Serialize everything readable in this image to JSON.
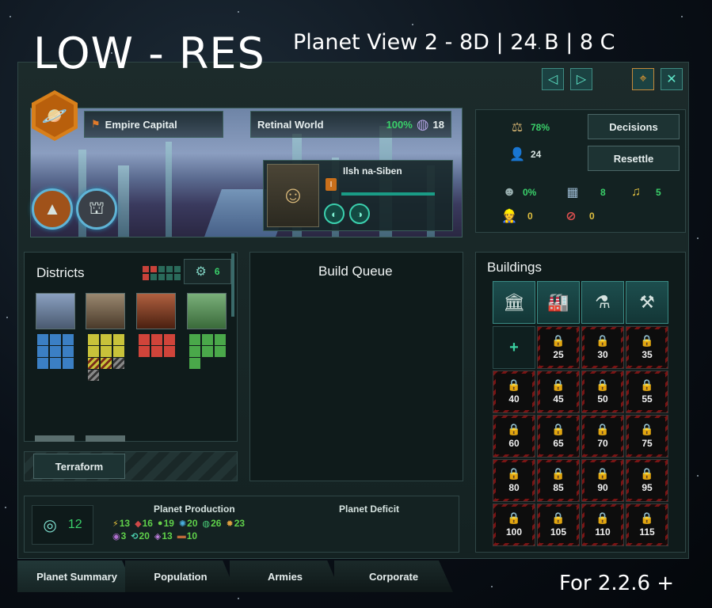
{
  "overlay": {
    "title": "LOW - RES",
    "subtitle": "Planet View 2 - 8D | 24 B | 8 C",
    "version": "For 2.2.6 +"
  },
  "header": {
    "capital_label": "Empire Capital",
    "planet_class": "Retinal World",
    "habitability": "100%",
    "planet_size": "18"
  },
  "leader": {
    "name": "Ilsh na-Siben",
    "level": "I"
  },
  "stats": {
    "stability": "78%",
    "population": "24",
    "crime": "0%",
    "housing": "8",
    "amenities": "5",
    "free_jobs": "0",
    "unemployed": "0",
    "decisions_label": "Decisions",
    "resettle_label": "Resettle"
  },
  "districts": {
    "title": "Districts",
    "free_slots": "6",
    "terraform_label": "Terraform",
    "colors": {
      "city": "#3b7fc4",
      "industry": "#c8c23a",
      "mining": "#d0443a",
      "farm": "#4aa84a"
    }
  },
  "build_queue": {
    "title": "Build Queue"
  },
  "buildings": {
    "title": "Buildings",
    "locked_slots": [
      "25",
      "30",
      "35",
      "40",
      "45",
      "50",
      "55",
      "60",
      "65",
      "70",
      "75",
      "80",
      "85",
      "90",
      "95",
      "100",
      "105",
      "110",
      "115"
    ]
  },
  "production": {
    "title": "Planet Production",
    "deficit_title": "Planet Deficit",
    "trade": "12",
    "row1": [
      {
        "icon": "energy-icon",
        "glyph": "⚡",
        "color": "#e6c23a",
        "value": "13"
      },
      {
        "icon": "minerals-icon",
        "glyph": "◆",
        "color": "#d04848",
        "value": "16"
      },
      {
        "icon": "food-icon",
        "glyph": "●",
        "color": "#6ad04a",
        "value": "19"
      },
      {
        "icon": "physics-icon",
        "glyph": "✺",
        "color": "#4ab0e0",
        "value": "20"
      },
      {
        "icon": "society-icon",
        "glyph": "◍",
        "color": "#4ad07a",
        "value": "26"
      },
      {
        "icon": "engineering-icon",
        "glyph": "✹",
        "color": "#e0a040",
        "value": "23"
      }
    ],
    "row2": [
      {
        "icon": "influence-icon",
        "glyph": "◉",
        "color": "#b070d0",
        "value": "3"
      },
      {
        "icon": "unity-icon",
        "glyph": "⟲",
        "color": "#4ad0b0",
        "value": "20"
      },
      {
        "icon": "consumer-goods-icon",
        "glyph": "◈",
        "color": "#c080e0",
        "value": "13"
      },
      {
        "icon": "alloys-icon",
        "glyph": "▬",
        "color": "#c06a3a",
        "value": "10"
      }
    ]
  },
  "tabs": [
    "Planet Summary",
    "Population",
    "Armies",
    "Corporate"
  ]
}
